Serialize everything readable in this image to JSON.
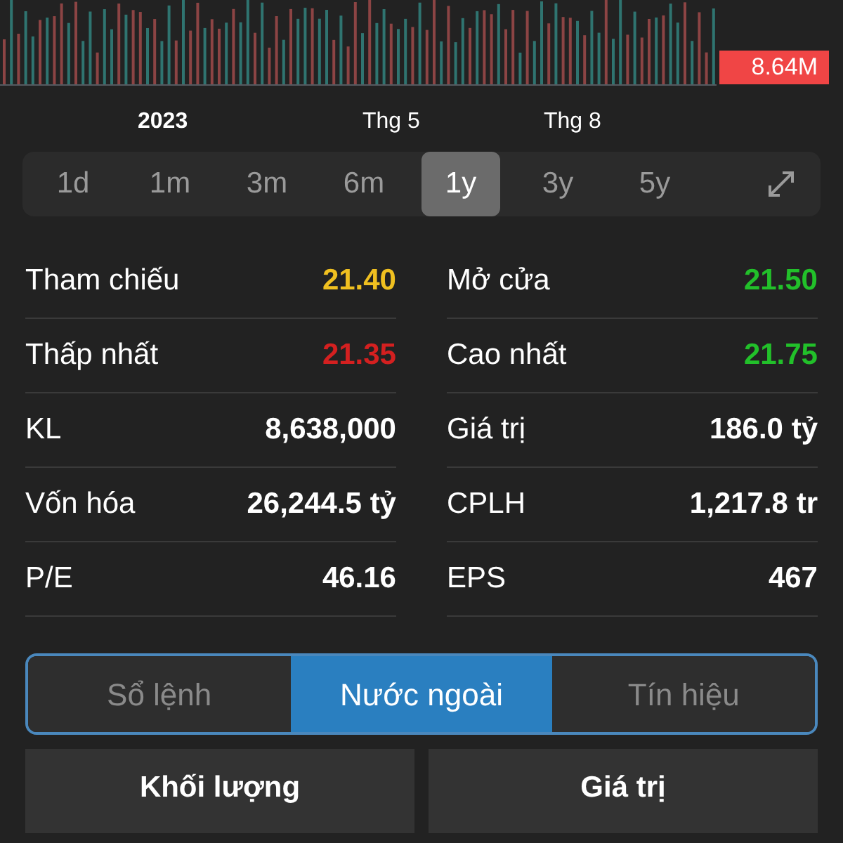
{
  "volume_chart": {
    "kind": "picture",
    "last_volume": "8.64M"
  },
  "time_axis": [
    "2023",
    "Thg 5",
    "Thg 8"
  ],
  "periods": [
    {
      "label": "1d",
      "selected": false
    },
    {
      "label": "1m",
      "selected": false
    },
    {
      "label": "3m",
      "selected": false
    },
    {
      "label": "6m",
      "selected": false
    },
    {
      "label": "1y",
      "selected": true
    },
    {
      "label": "3y",
      "selected": false
    },
    {
      "label": "5y",
      "selected": false
    }
  ],
  "stats": [
    [
      {
        "label": "Tham chiếu",
        "value": "21.40",
        "color": "#f0c020"
      },
      {
        "label": "Mở cửa",
        "value": "21.50",
        "color": "#22c02a"
      }
    ],
    [
      {
        "label": "Thấp nhất",
        "value": "21.35",
        "color": "#d42020"
      },
      {
        "label": "Cao nhất",
        "value": "21.75",
        "color": "#22c02a"
      }
    ],
    [
      {
        "label": "KL",
        "value": "8,638,000",
        "color": "#ffffff"
      },
      {
        "label": "Giá trị",
        "value": "186.0 tỷ",
        "color": "#ffffff"
      }
    ],
    [
      {
        "label": "Vốn hóa",
        "value": "26,244.5 tỷ",
        "color": "#ffffff"
      },
      {
        "label": "CPLH",
        "value": "1,217.8 tr",
        "color": "#ffffff"
      }
    ],
    [
      {
        "label": "P/E",
        "value": "46.16",
        "color": "#ffffff"
      },
      {
        "label": "EPS",
        "value": "467",
        "color": "#ffffff"
      }
    ]
  ],
  "tabs": [
    {
      "label": "Sổ lệnh",
      "selected": false
    },
    {
      "label": "Nước ngoài",
      "selected": true
    },
    {
      "label": "Tín hiệu",
      "selected": false
    }
  ],
  "sub_tabs": [
    "Khối lượng",
    "Giá trị"
  ]
}
